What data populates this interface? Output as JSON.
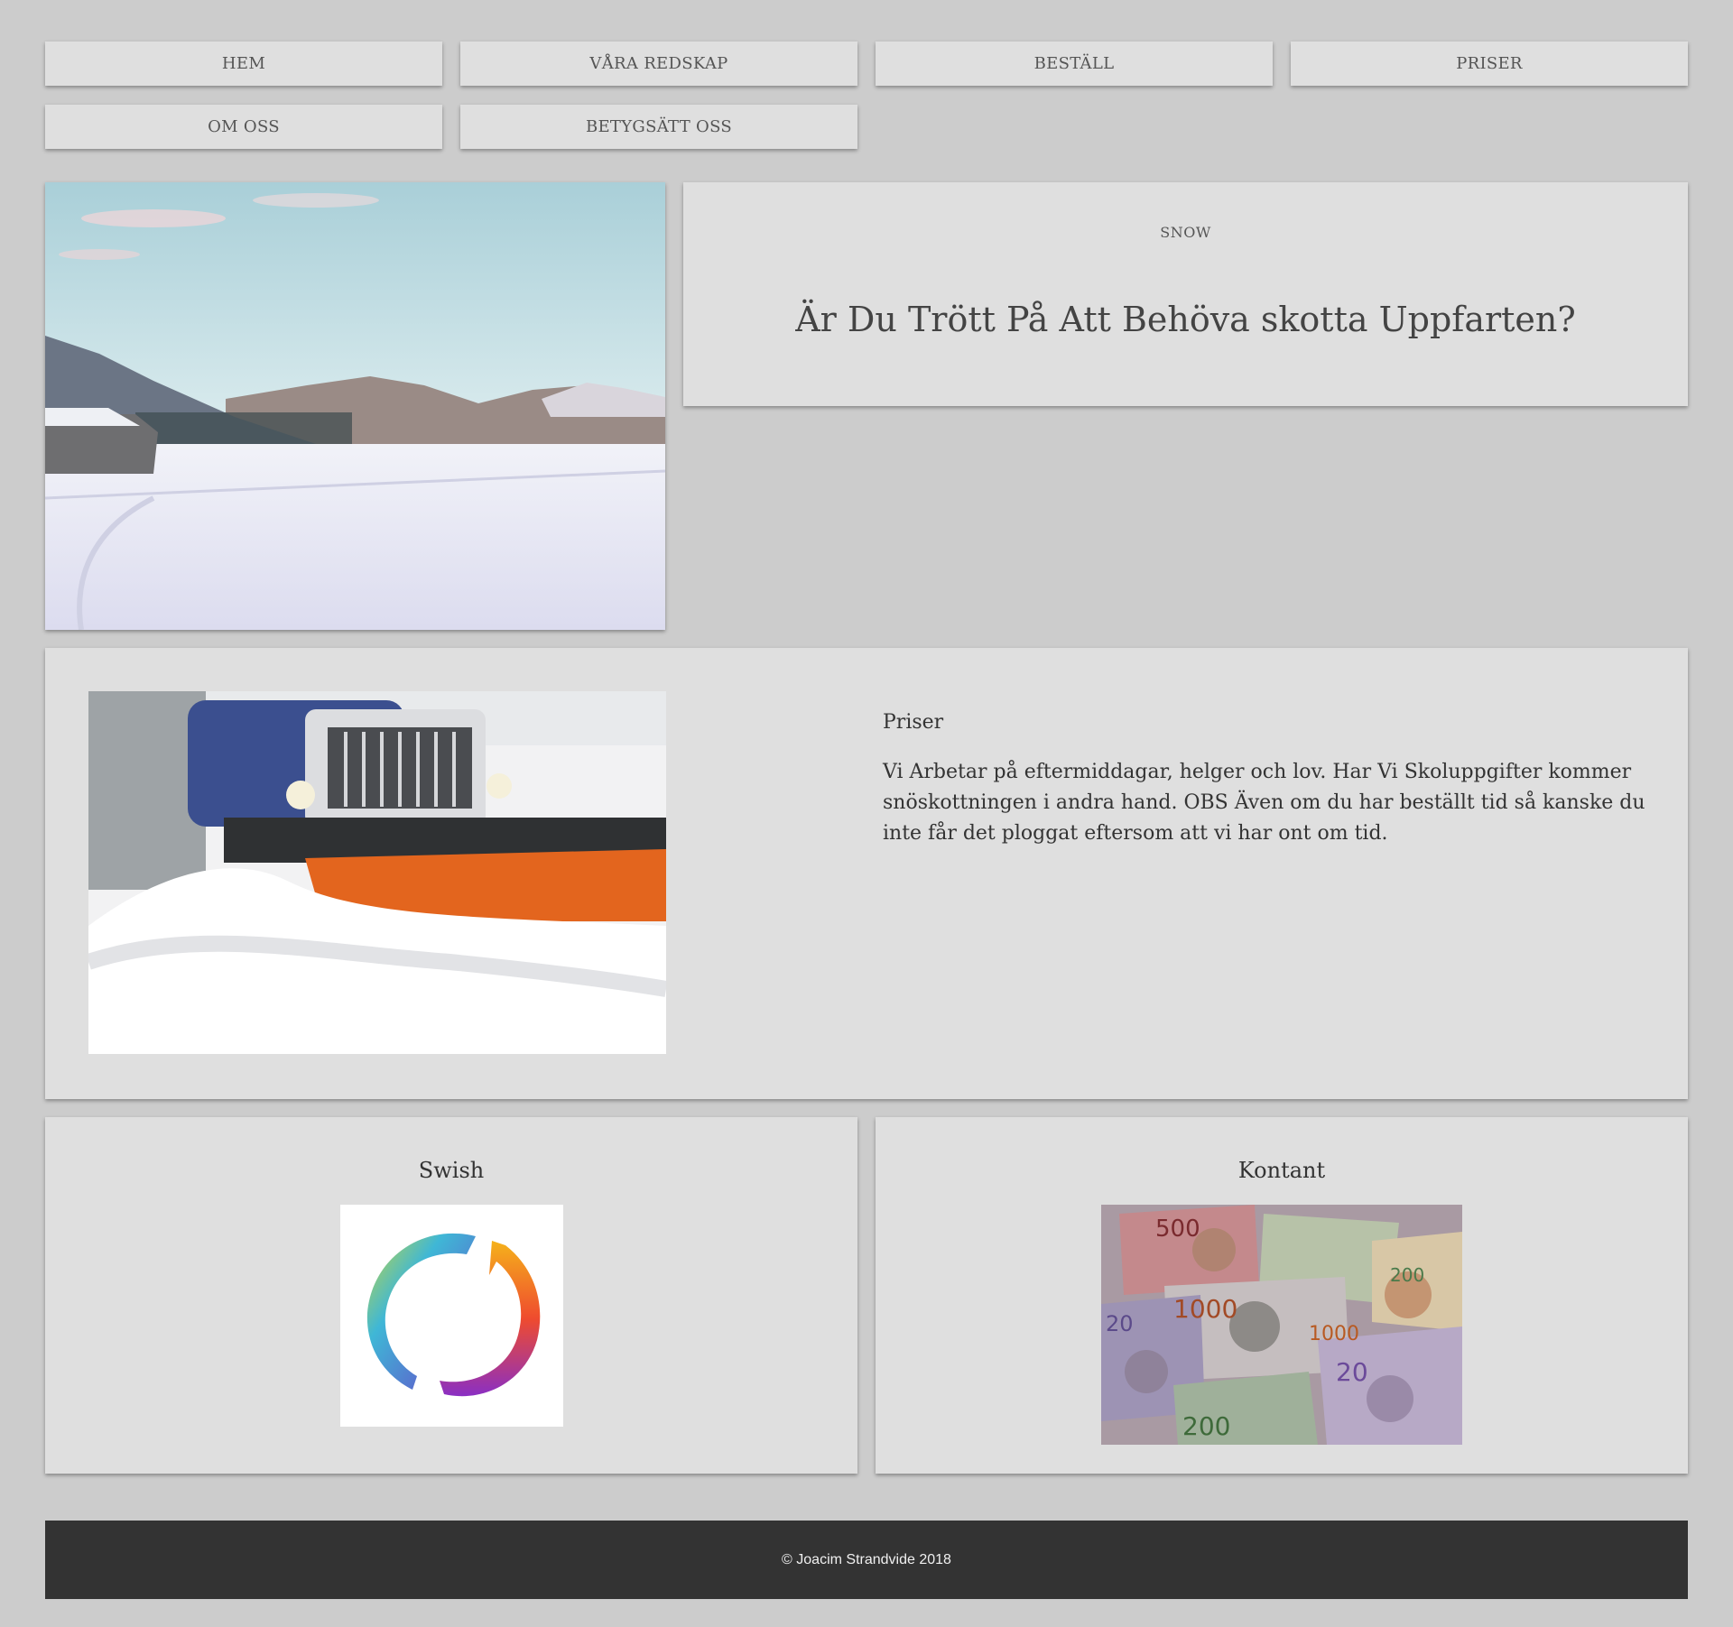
{
  "nav": {
    "items": [
      {
        "label": "HEM"
      },
      {
        "label": "VÅRA REDSKAP"
      },
      {
        "label": "BESTÄLL"
      },
      {
        "label": "PRISER"
      },
      {
        "label": "OM OSS"
      },
      {
        "label": "BETYGSÄTT OSS"
      }
    ]
  },
  "hero": {
    "kicker": "SNOW",
    "heading": "Är Du Trött På Att Behöva skotta Uppfarten?",
    "image_icon": "winter-landscape-photo"
  },
  "pricing": {
    "title": "Priser",
    "text": "Vi Arbetar på eftermiddagar, helger och lov. Har Vi Skoluppgifter kommer snöskottningen i andra hand. OBS Även om du har beställt tid så kanske du inte får det ploggat eftersom att vi har ont om tid.",
    "image_icon": "snowplow-truck-photo"
  },
  "payment": {
    "swish": {
      "title": "Swish",
      "icon": "swish-logo"
    },
    "cash": {
      "title": "Kontant",
      "icon": "swedish-banknotes-photo"
    }
  },
  "footer": {
    "text": "© Joacim Strandvide 2018"
  }
}
